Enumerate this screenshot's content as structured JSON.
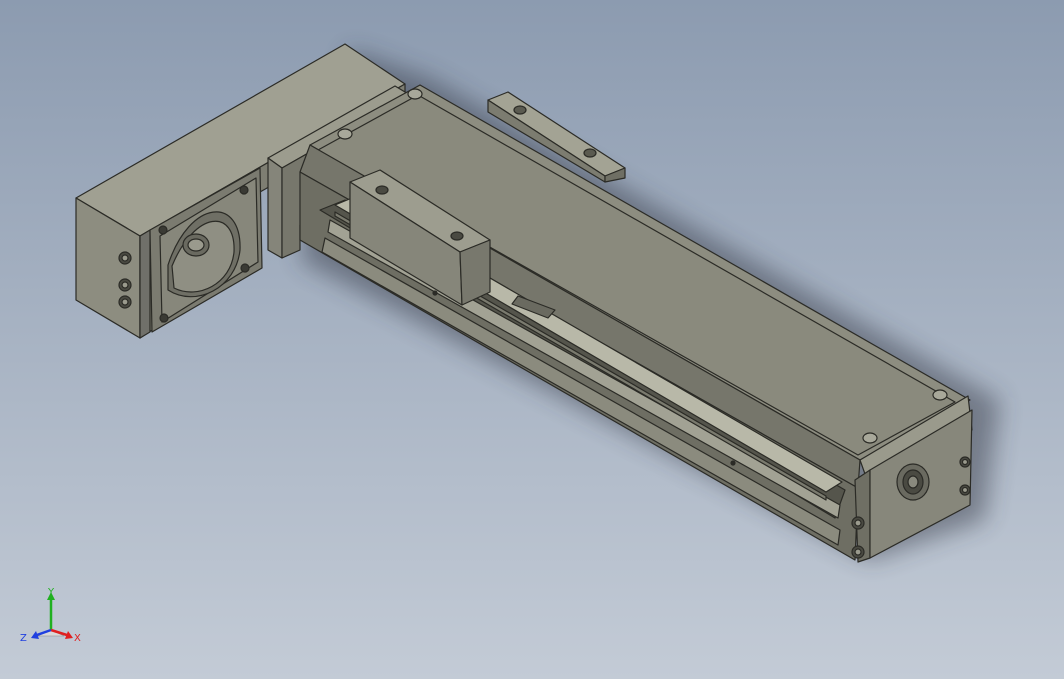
{
  "viewport": {
    "background_top": "#8c9bb0",
    "background_bottom": "#c3cbd6",
    "model_color": "#8d8d80",
    "edge_color": "#2b2b26"
  },
  "triad": {
    "x_label": "X",
    "y_label": "Y",
    "z_label": "Z",
    "x_color": "#e02020",
    "y_color": "#20b020",
    "z_color": "#2040e0"
  }
}
